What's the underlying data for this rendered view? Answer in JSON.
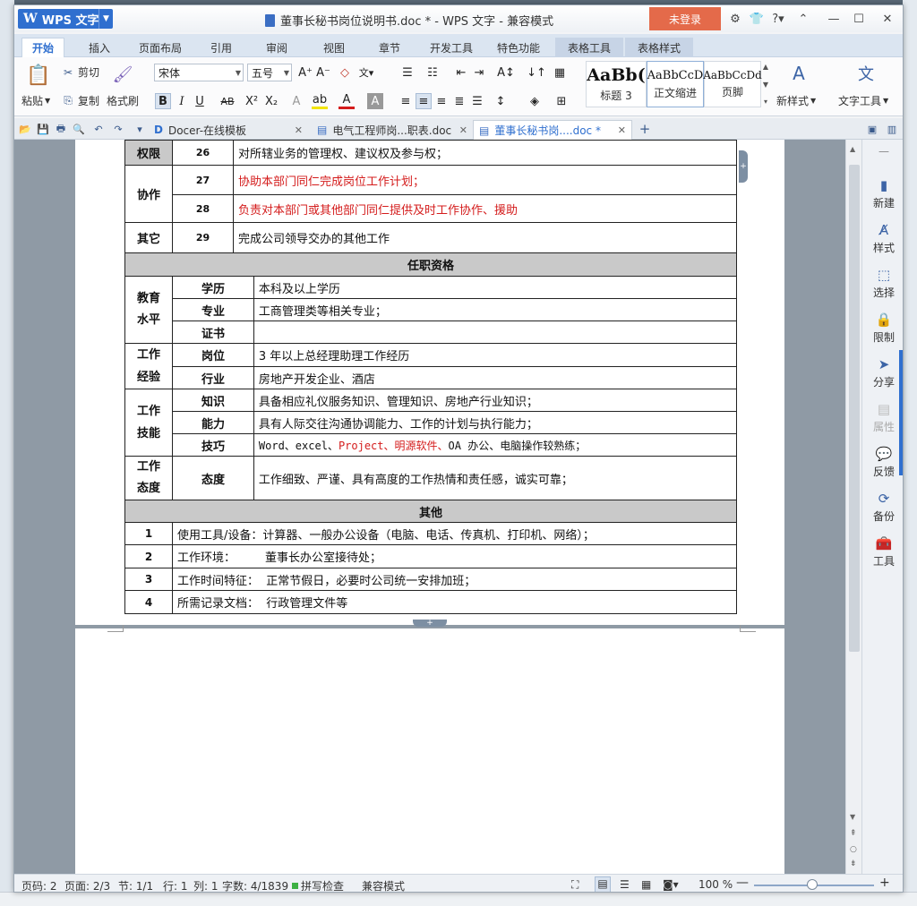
{
  "titlebar": {
    "app_menu": "WPS 文字",
    "doc_title": "董事长秘书岗位说明书.doc * - WPS 文字 - 兼容模式",
    "login": "未登录"
  },
  "ribbon_tabs": [
    "开始",
    "插入",
    "页面布局",
    "引用",
    "审阅",
    "视图",
    "章节",
    "开发工具",
    "特色功能",
    "表格工具",
    "表格样式"
  ],
  "ribbon": {
    "paste": "粘贴",
    "cut": "剪切",
    "copy": "复制",
    "format_painter": "格式刷",
    "font_name": "宋体",
    "font_size": "五号",
    "styles": [
      {
        "preview": "AaBb(",
        "label": "标题 3"
      },
      {
        "preview": "AaBbCcD",
        "label": "正文缩进"
      },
      {
        "preview": "AaBbCcDd",
        "label": "页脚"
      }
    ],
    "new_style": "新样式",
    "text_tools": "文字工具"
  },
  "doc_tabs": [
    {
      "label": "Docer-在线模板"
    },
    {
      "label": "电气工程师岗...职表.doc"
    },
    {
      "label": "董事长秘书岗....doc *"
    }
  ],
  "table": {
    "row_quanxian": {
      "cat": "权限",
      "num": "26",
      "text": "对所辖业务的管理权、建议权及参与权；"
    },
    "xiezuo": {
      "cat": "协作",
      "rows": [
        {
          "num": "27",
          "text": "协助本部门同仁完成岗位工作计划；"
        },
        {
          "num": "28",
          "text": "负责对本部门或其他部门同仁提供及时工作协作、援助"
        }
      ]
    },
    "qita_row": {
      "cat": "其它",
      "num": "29",
      "text": "完成公司领导交办的其他工作"
    },
    "section_qualifications": "任职资格",
    "edu": {
      "cat": "教育\n水平",
      "rows": [
        {
          "sub": "学历",
          "text": "本科及以上学历"
        },
        {
          "sub": "专业",
          "text": "工商管理类等相关专业；"
        },
        {
          "sub": "证书",
          "text": ""
        }
      ]
    },
    "exp": {
      "cat": "工作\n经验",
      "rows": [
        {
          "sub": "岗位",
          "text": "3 年以上总经理助理工作经历"
        },
        {
          "sub": "行业",
          "text": "房地产开发企业、酒店"
        }
      ]
    },
    "skill": {
      "cat": "工作\n技能",
      "rows": [
        {
          "sub": "知识",
          "text": "具备相应礼仪服务知识、管理知识、房地产行业知识；"
        },
        {
          "sub": "能力",
          "text": "具有人际交往沟通协调能力、工作的计划与执行能力；"
        },
        {
          "sub": "技巧",
          "text_a": "Word、excel、",
          "text_red": "Project、明源软件、",
          "text_b": "OA 办公、电脑操作较熟练；"
        }
      ]
    },
    "attitude": {
      "cat": "工作\n态度",
      "sub": "态度",
      "text": "工作细致、严谨、具有高度的工作热情和责任感，诚实可靠；"
    },
    "section_other": "其他",
    "other_rows": [
      {
        "num": "1",
        "text": "使用工具/设备：计算器、一般办公设备（电脑、电话、传真机、打印机、网络）；"
      },
      {
        "num": "2",
        "text": "工作环境：        董事长办公室接待处；"
      },
      {
        "num": "3",
        "text": "工作时间特征：  正常节假日，必要时公司统一安排加班；"
      },
      {
        "num": "4",
        "text": "所需记录文档：  行政管理文件等"
      }
    ]
  },
  "right_pane": [
    "新建",
    "样式",
    "选择",
    "限制",
    "分享",
    "属性",
    "反馈",
    "备份",
    "工具"
  ],
  "status": {
    "page_code": "页码: 2",
    "pages": "页面: 2/3",
    "section": "节: 1/1",
    "row": "行: 1",
    "col": "列: 1",
    "words": "字数: 4/1839",
    "spell": "拼写检查",
    "compat": "兼容模式",
    "zoom": "100 %"
  },
  "colors": {
    "accent": "#2f6fcf",
    "login": "#e46a4a",
    "red_text": "#d41c1c"
  }
}
